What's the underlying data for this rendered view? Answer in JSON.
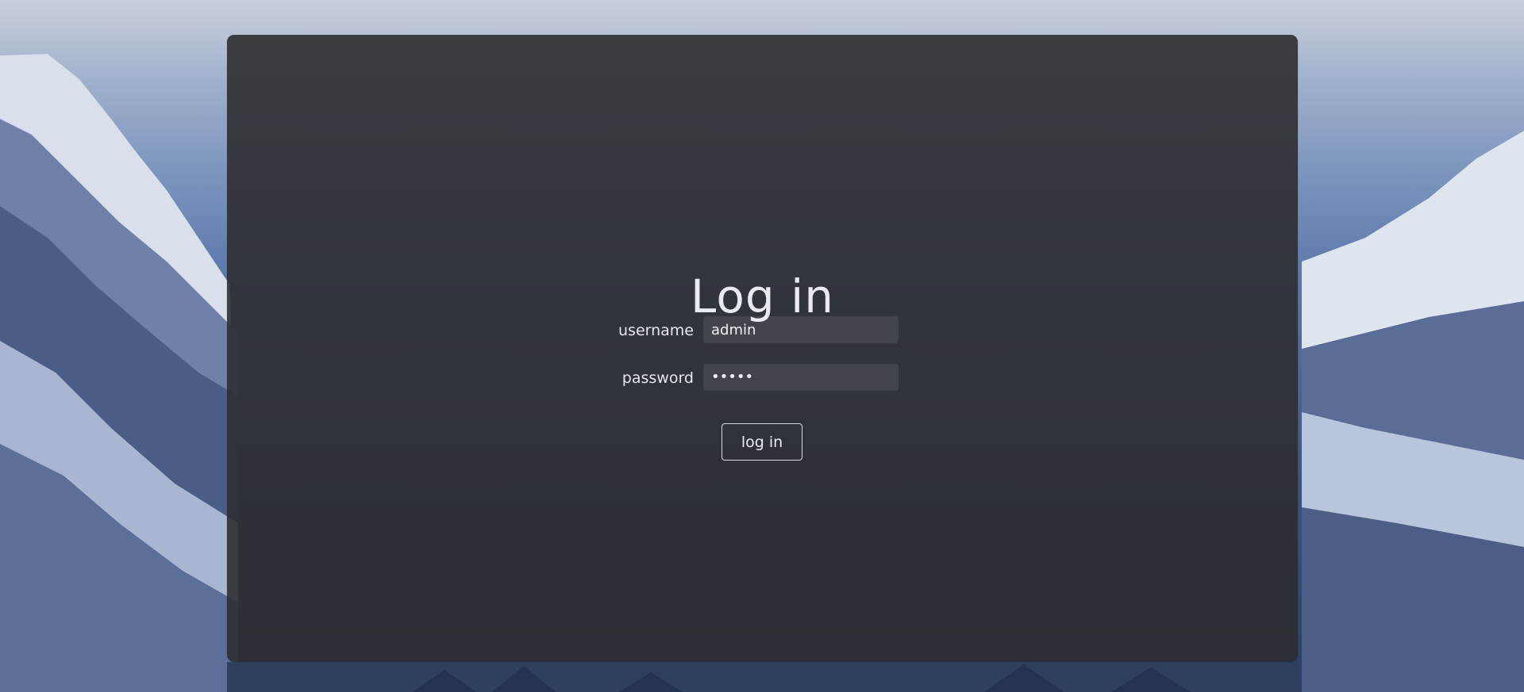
{
  "login": {
    "title": "Log in",
    "username_label": "username",
    "username_value": "admin",
    "password_label": "password",
    "password_display": "•••••",
    "submit_label": "log in"
  }
}
